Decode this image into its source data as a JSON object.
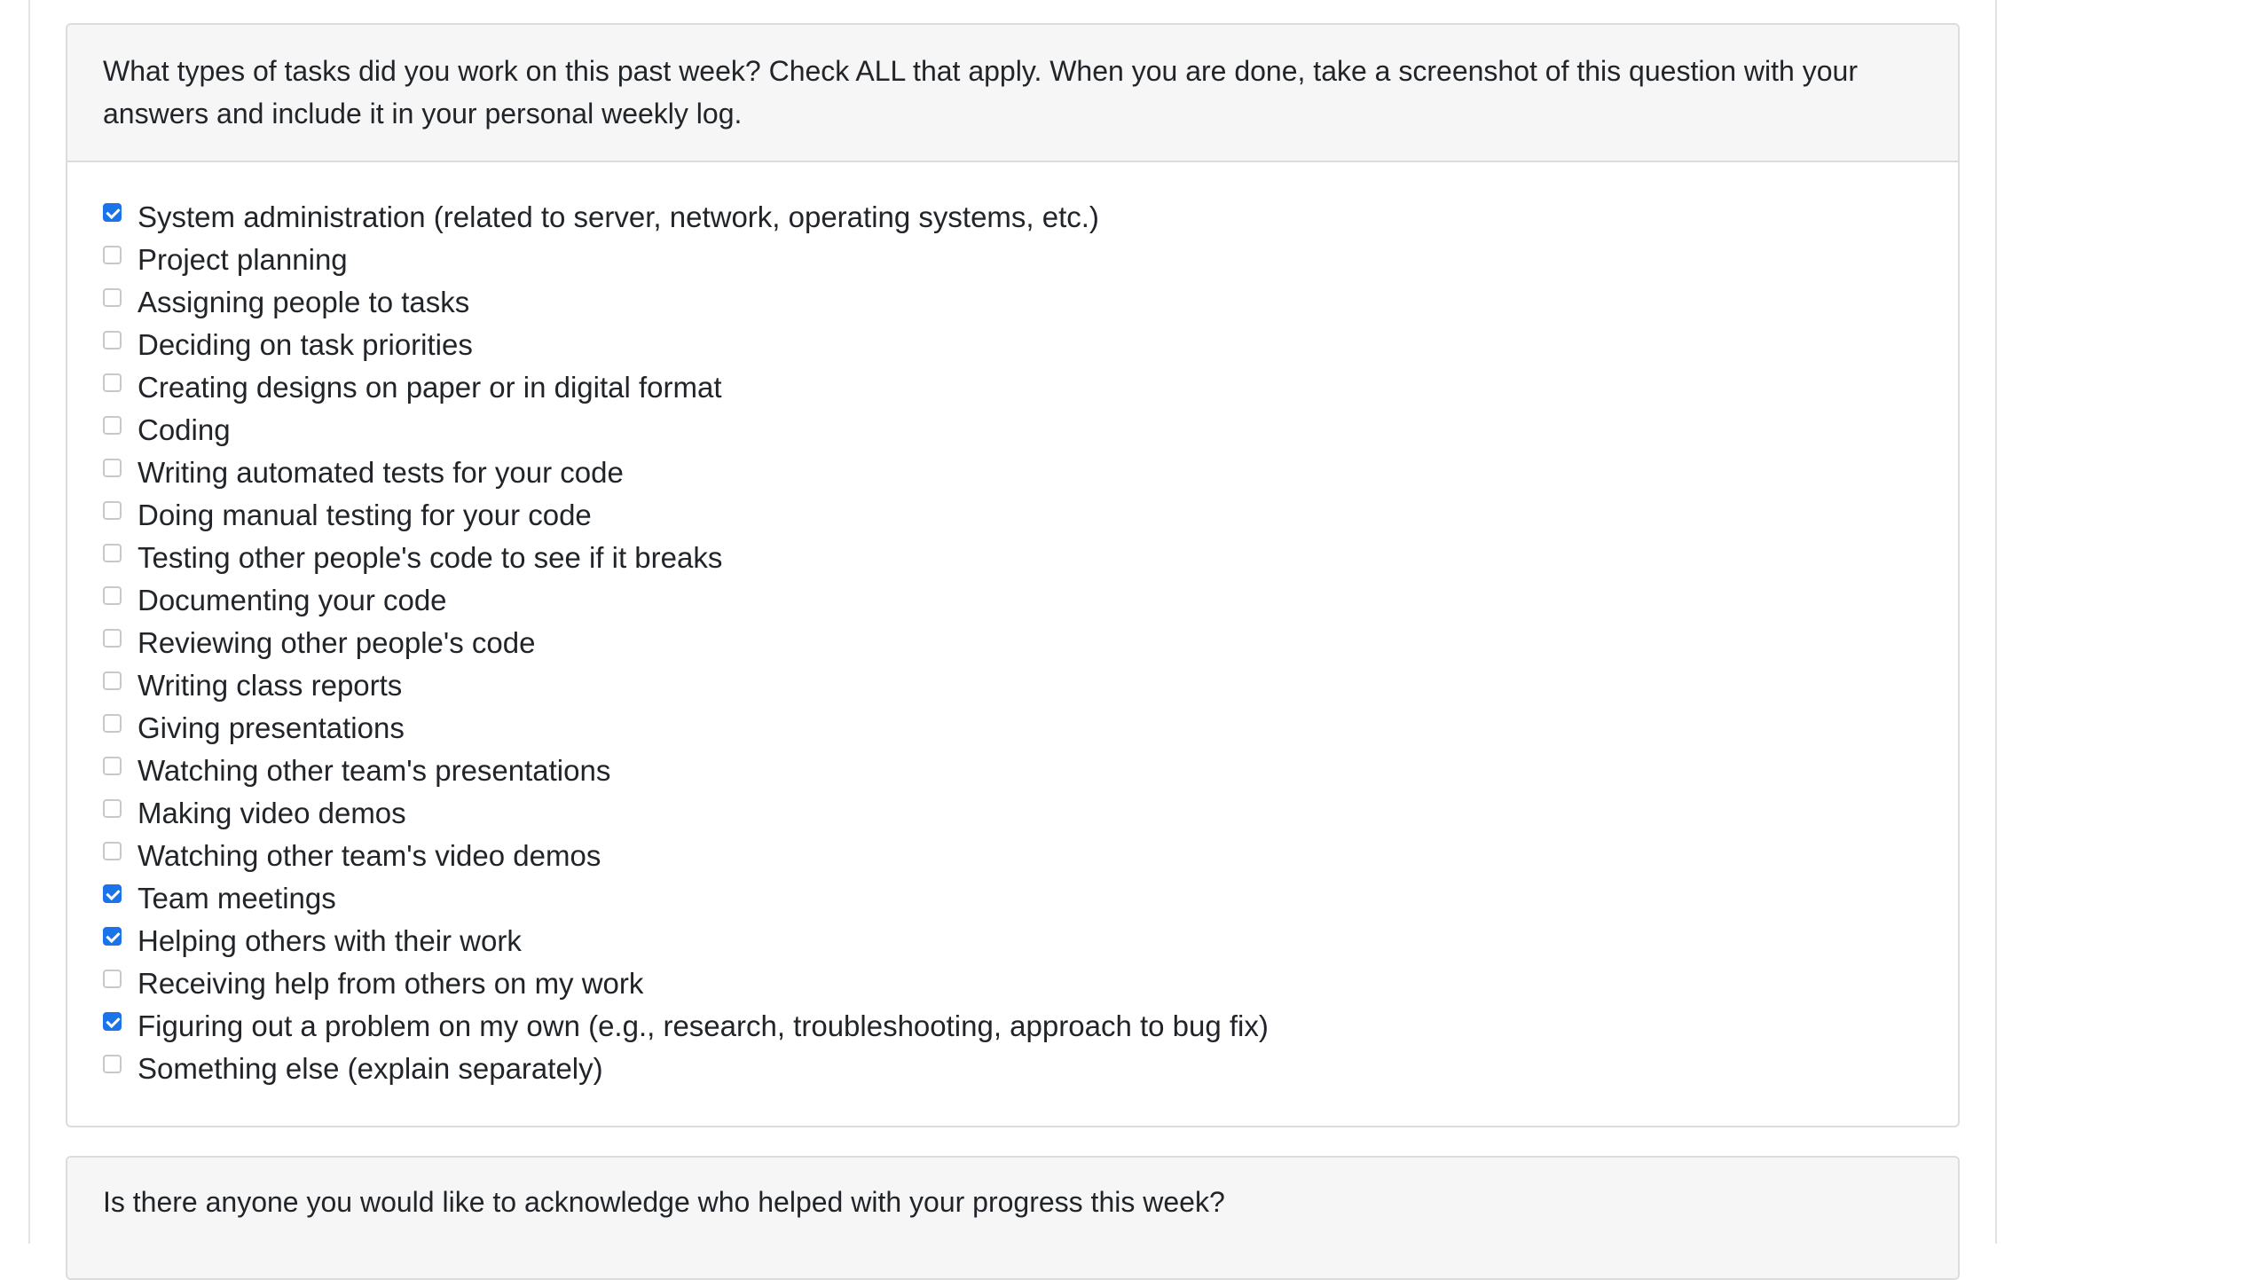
{
  "question1": {
    "prompt": "What types of tasks did you work on this past week? Check ALL that apply. When you are done, take a screenshot of this question with your answers and include it in your personal weekly log.",
    "options": [
      {
        "label": "System administration (related to server, network, operating systems, etc.)",
        "checked": true
      },
      {
        "label": "Project planning",
        "checked": false
      },
      {
        "label": "Assigning people to tasks",
        "checked": false
      },
      {
        "label": "Deciding on task priorities",
        "checked": false
      },
      {
        "label": "Creating designs on paper or in digital format",
        "checked": false
      },
      {
        "label": "Coding",
        "checked": false
      },
      {
        "label": "Writing automated tests for your code",
        "checked": false
      },
      {
        "label": "Doing manual testing for your code",
        "checked": false
      },
      {
        "label": "Testing other people's code to see if it breaks",
        "checked": false
      },
      {
        "label": "Documenting your code",
        "checked": false
      },
      {
        "label": "Reviewing other people's code",
        "checked": false
      },
      {
        "label": "Writing class reports",
        "checked": false
      },
      {
        "label": "Giving presentations",
        "checked": false
      },
      {
        "label": "Watching other team's presentations",
        "checked": false
      },
      {
        "label": "Making video demos",
        "checked": false
      },
      {
        "label": "Watching other team's video demos",
        "checked": false
      },
      {
        "label": "Team meetings",
        "checked": true
      },
      {
        "label": "Helping others with their work",
        "checked": true
      },
      {
        "label": "Receiving help from others on my work",
        "checked": false
      },
      {
        "label": "Figuring out a problem on my own (e.g., research, troubleshooting, approach to bug fix)",
        "checked": true
      },
      {
        "label": "Something else (explain separately)",
        "checked": false
      }
    ]
  },
  "question2": {
    "prompt": "Is there anyone you would like to acknowledge who helped with your progress this week?"
  },
  "colors": {
    "checked_accent": "#1a73e8",
    "header_background": "#f6f6f6",
    "border": "#dcdcdc"
  }
}
